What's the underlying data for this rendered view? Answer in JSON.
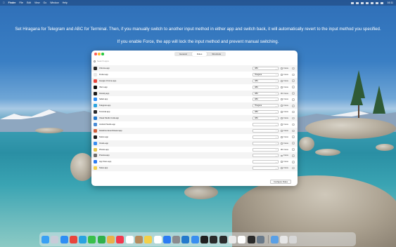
{
  "menubar": {
    "items": [
      "Finder",
      "File",
      "Edit",
      "View",
      "Go",
      "Window",
      "Help"
    ],
    "clock": "16:11"
  },
  "overlay": {
    "line1": "Set Hiragana for Telegram and ABC for Terminal. Then, if you manually switch to another input method in either app and switch back, it will automatically revert to the input method you specified.",
    "line2": "If you enable Force, the app will lock the input method and prevent manual switching."
  },
  "window": {
    "tabs": [
      "General",
      "Rules",
      "Shortcuts"
    ],
    "active_tab": "Rules",
    "search_placeholder": "Search apps",
    "force_label": "Force",
    "configure_button": "Configure Rules",
    "rows": [
      {
        "name": "Chrome.app",
        "method": "ABC",
        "color": "#2a2a2a"
      },
      {
        "name": "Finder.app",
        "method": "Hiragana",
        "color": "#e8e8e8"
      },
      {
        "name": "Google Chrome.app",
        "method": "ABC",
        "color": "#e8453c"
      },
      {
        "name": "iTerm.app",
        "method": "ABC",
        "color": "#111111"
      },
      {
        "name": "Ghostty.app",
        "method": "ABC",
        "color": "#1b1b1b"
      },
      {
        "name": "Safari.app",
        "method": "ABC",
        "color": "#2f8ef4"
      },
      {
        "name": "Telegram.app",
        "method": "Hiragana",
        "color": "#2aa3e0"
      },
      {
        "name": "Terminal.app",
        "method": "ABC",
        "color": "#2a2a2a"
      },
      {
        "name": "Visual Studio Code.app",
        "method": "ABC",
        "color": "#2479cc"
      },
      {
        "name": "Android Studio.app",
        "method": "",
        "color": "#4a8bd6"
      },
      {
        "name": "Karabiner-EventViewer.app",
        "method": "",
        "color": "#d05e3a"
      },
      {
        "name": "Notion.app",
        "method": "",
        "color": "#1f1f1f"
      },
      {
        "name": "Xcode.app",
        "method": "",
        "color": "#3a8ef0"
      },
      {
        "name": "Photos.app",
        "method": "",
        "color": "#e4c44c"
      },
      {
        "name": "Preview.app",
        "method": "",
        "color": "#6c6c6c"
      },
      {
        "name": "App Store.app",
        "method": "",
        "color": "#2b7bf3"
      },
      {
        "name": "Notes.app",
        "method": "",
        "color": "#f3d04a"
      }
    ]
  },
  "dock": {
    "icons": [
      {
        "name": "finder",
        "color": "#3aa0f4"
      },
      {
        "name": "launchpad",
        "color": "#c8ccd8"
      },
      {
        "name": "safari",
        "color": "#2f8ef4"
      },
      {
        "name": "chrome",
        "color": "#e8453c"
      },
      {
        "name": "telegram",
        "color": "#2aa3e0"
      },
      {
        "name": "messages",
        "color": "#39c04a"
      },
      {
        "name": "facetime",
        "color": "#2fb04a"
      },
      {
        "name": "photos",
        "color": "#e9b14a"
      },
      {
        "name": "music",
        "color": "#f2384f"
      },
      {
        "name": "calendar",
        "color": "#ffffff"
      },
      {
        "name": "contacts",
        "color": "#b58b5e"
      },
      {
        "name": "notes",
        "color": "#f3d04a"
      },
      {
        "name": "reminders",
        "color": "#ffffff"
      },
      {
        "name": "app-store",
        "color": "#2b7bf3"
      },
      {
        "name": "settings",
        "color": "#8a8a8e"
      },
      {
        "name": "vscode",
        "color": "#2479cc"
      },
      {
        "name": "xcode",
        "color": "#3a8ef0"
      },
      {
        "name": "iterm",
        "color": "#1f1f1f"
      },
      {
        "name": "terminal",
        "color": "#2a2a2a"
      },
      {
        "name": "activity",
        "color": "#2b2b2b"
      },
      {
        "name": "chatgpt",
        "color": "#e8e8e8"
      },
      {
        "name": "notion",
        "color": "#ffffff"
      },
      {
        "name": "figma",
        "color": "#2a2a2a"
      },
      {
        "name": "preview",
        "color": "#6a7a8a"
      }
    ],
    "after_sep": [
      {
        "name": "downloads",
        "color": "#5aa0e6"
      },
      {
        "name": "folder",
        "color": "#e6e6e6"
      },
      {
        "name": "trash",
        "color": "#d6d6d6"
      }
    ]
  }
}
